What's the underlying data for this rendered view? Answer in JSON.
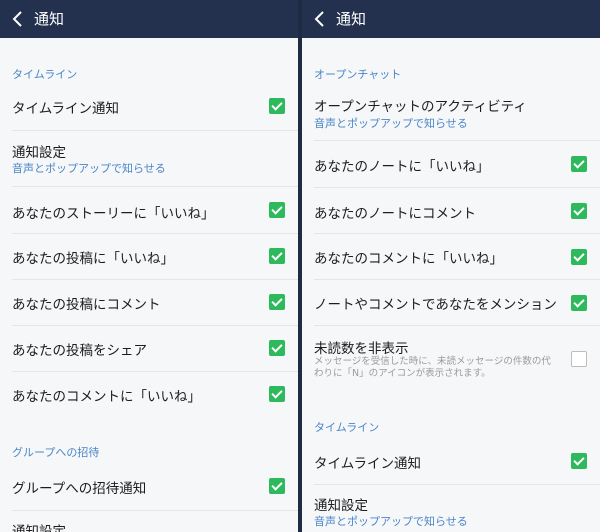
{
  "left": {
    "title": "通知",
    "section_timeline": "タイムライン",
    "timeline_notify": "タイムライン通知",
    "notify_settings": "通知設定",
    "notify_settings_sub": "音声とポップアップで知らせる",
    "story_like": "あなたのストーリーに「いいね」",
    "post_like": "あなたの投稿に「いいね」",
    "post_comment": "あなたの投稿にコメント",
    "post_share": "あなたの投稿をシェア",
    "comment_like": "あなたのコメントに「いいね」",
    "section_group": "グループへの招待",
    "group_invite": "グループへの招待通知",
    "notify_settings_2": "通知設定"
  },
  "right": {
    "title": "通知",
    "section_openchat": "オープンチャット",
    "openchat_activity": "オープンチャットのアクティビティ",
    "openchat_activity_sub": "音声とポップアップで知らせる",
    "note_like": "あなたのノートに「いいね」",
    "note_comment": "あなたのノートにコメント",
    "comment_like": "あなたのコメントに「いいね」",
    "mention": "ノートやコメントであなたをメンション",
    "hide_unread": "未読数を非表示",
    "hide_unread_desc": "メッセージを受信した時に、未読メッセージの件数の代わりに「N」のアイコンが表示されます。",
    "section_timeline": "タイムライン",
    "timeline_notify": "タイムライン通知",
    "notify_settings": "通知設定",
    "notify_settings_sub": "音声とポップアップで知らせる"
  },
  "colors": {
    "header": "#24314e",
    "accent": "#4a86c8",
    "check": "#2db95c"
  },
  "checkboxes": {
    "left_timeline_notify": true,
    "left_story_like": true,
    "left_post_like": true,
    "left_post_comment": true,
    "left_post_share": true,
    "left_comment_like": true,
    "left_group_invite": true,
    "right_note_like": true,
    "right_note_comment": true,
    "right_comment_like": true,
    "right_mention": true,
    "right_hide_unread": false,
    "right_timeline_notify": true
  }
}
